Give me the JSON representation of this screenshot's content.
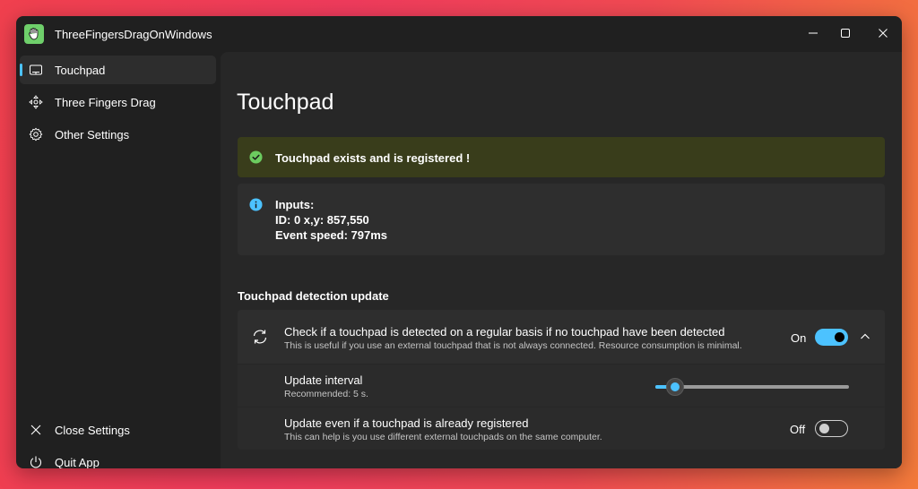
{
  "window": {
    "title": "ThreeFingersDragOnWindows",
    "controls": [
      "minimize-icon",
      "maximize-icon",
      "close-icon"
    ]
  },
  "sidebar": {
    "items": [
      {
        "label": "Touchpad",
        "icon": "touchpad-icon",
        "active": true
      },
      {
        "label": "Three Fingers Drag",
        "icon": "drag-icon",
        "active": false
      },
      {
        "label": "Other Settings",
        "icon": "gear-icon",
        "active": false
      }
    ],
    "footer_items": [
      {
        "label": "Close Settings",
        "icon": "close-icon"
      },
      {
        "label": "Quit App",
        "icon": "power-icon"
      }
    ]
  },
  "main": {
    "page_title": "Touchpad",
    "status": {
      "text": "Touchpad exists and is registered !",
      "icon": "check-circle-icon",
      "color": "#6ccb5f"
    },
    "info": {
      "icon": "info-icon",
      "lines": [
        "Inputs:",
        "ID: 0 x,y: 857,550",
        "Event speed: 797ms"
      ]
    },
    "section_title": "Touchpad detection update",
    "settings": {
      "regular_check": {
        "title": "Check if a touchpad is detected on a regular basis if no touchpad have been detected",
        "subtitle": "This is useful if you use an external touchpad that is not always connected. Resource consumption is minimal.",
        "icon": "refresh-icon",
        "state_label": "On",
        "enabled": true,
        "expanded": true
      },
      "update_interval": {
        "title": "Update interval",
        "subtitle": "Recommended: 5 s.",
        "slider_fraction": 0.1
      },
      "update_registered": {
        "title": "Update even if a touchpad is already registered",
        "subtitle": "This can help is you use different external touchpads on the same computer.",
        "state_label": "Off",
        "enabled": false
      }
    }
  },
  "colors": {
    "accent": "#4cc2ff",
    "success_bg": "#393d1b",
    "window_bg": "#202020",
    "content_bg": "#272727"
  }
}
